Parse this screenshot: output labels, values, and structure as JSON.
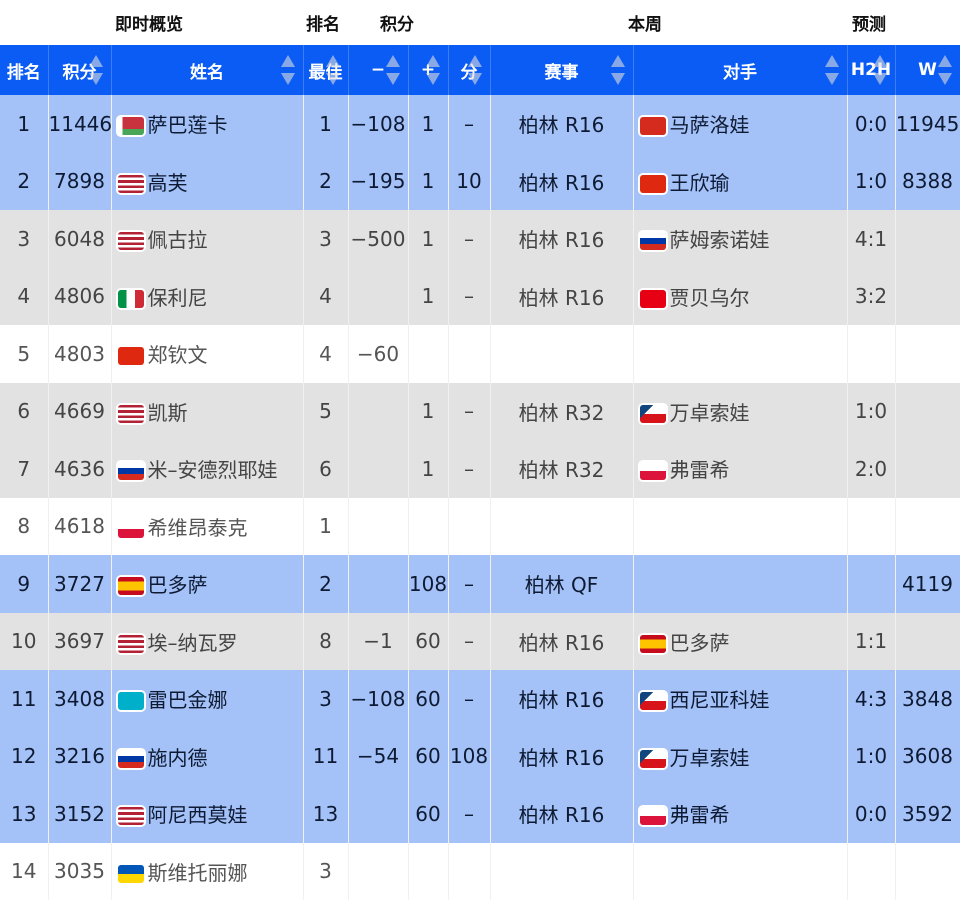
{
  "groups": {
    "live": "即时概览",
    "rank": "排名",
    "points": "积分",
    "week": "本周",
    "forecast": "预测"
  },
  "headers": [
    "排名",
    "积分",
    "姓名",
    "最佳",
    "−",
    "+",
    "分",
    "赛事",
    "对手",
    "H2H",
    "W"
  ],
  "colors": {
    "header": "#0b5cf5",
    "blue_row": "#a4c2f7",
    "gray_row": "#e2e2e2"
  },
  "rows": [
    {
      "rank": "1",
      "pts": "11446",
      "flag": "BLR",
      "name": "萨巴莲卡",
      "best": "1",
      "minus": "−108",
      "plus": "1",
      "fen": "–",
      "event": "柏林 R16",
      "oflag": "SUI",
      "opp": "马萨洛娃",
      "h2h": "0:0",
      "w": "11945",
      "style": "blue"
    },
    {
      "rank": "2",
      "pts": "7898",
      "flag": "USA",
      "name": "高芙",
      "best": "2",
      "minus": "−195",
      "plus": "1",
      "fen": "10",
      "event": "柏林 R16",
      "oflag": "CHN",
      "opp": "王欣瑜",
      "h2h": "1:0",
      "w": "8388",
      "style": "blue"
    },
    {
      "rank": "3",
      "pts": "6048",
      "flag": "USA",
      "name": "佩古拉",
      "best": "3",
      "minus": "−500",
      "plus": "1",
      "fen": "–",
      "event": "柏林 R16",
      "oflag": "RUS",
      "opp": "萨姆索诺娃",
      "h2h": "4:1",
      "w": "",
      "style": "gray"
    },
    {
      "rank": "4",
      "pts": "4806",
      "flag": "ITA",
      "name": "保利尼",
      "best": "4",
      "minus": "",
      "plus": "1",
      "fen": "–",
      "event": "柏林 R16",
      "oflag": "TUN",
      "opp": "贾贝乌尔",
      "h2h": "3:2",
      "w": "",
      "style": "gray"
    },
    {
      "rank": "5",
      "pts": "4803",
      "flag": "CHN",
      "name": "郑钦文",
      "best": "4",
      "minus": "−60",
      "plus": "",
      "fen": "",
      "event": "",
      "oflag": "",
      "opp": "",
      "h2h": "",
      "w": "",
      "style": "white"
    },
    {
      "rank": "6",
      "pts": "4669",
      "flag": "USA",
      "name": "凯斯",
      "best": "5",
      "minus": "",
      "plus": "1",
      "fen": "–",
      "event": "柏林 R32",
      "oflag": "CZE",
      "opp": "万卓索娃",
      "h2h": "1:0",
      "w": "",
      "style": "gray"
    },
    {
      "rank": "7",
      "pts": "4636",
      "flag": "RUS",
      "name": "米–安德烈耶娃",
      "best": "6",
      "minus": "",
      "plus": "1",
      "fen": "–",
      "event": "柏林 R32",
      "oflag": "POL",
      "opp": "弗雷希",
      "h2h": "2:0",
      "w": "",
      "style": "gray"
    },
    {
      "rank": "8",
      "pts": "4618",
      "flag": "POL",
      "name": "希维昂泰克",
      "best": "1",
      "minus": "",
      "plus": "",
      "fen": "",
      "event": "",
      "oflag": "",
      "opp": "",
      "h2h": "",
      "w": "",
      "style": "white"
    },
    {
      "rank": "9",
      "pts": "3727",
      "flag": "ESP",
      "name": "巴多萨",
      "best": "2",
      "minus": "",
      "plus": "108",
      "fen": "–",
      "event": "柏林 QF",
      "oflag": "",
      "opp": "",
      "h2h": "",
      "w": "4119",
      "style": "blue"
    },
    {
      "rank": "10",
      "pts": "3697",
      "flag": "USA",
      "name": "埃–纳瓦罗",
      "best": "8",
      "minus": "−1",
      "plus": "60",
      "fen": "–",
      "event": "柏林 R16",
      "oflag": "ESP",
      "opp": "巴多萨",
      "h2h": "1:1",
      "w": "",
      "style": "gray"
    },
    {
      "rank": "11",
      "pts": "3408",
      "flag": "KAZ",
      "name": "雷巴金娜",
      "best": "3",
      "minus": "−108",
      "plus": "60",
      "fen": "–",
      "event": "柏林 R16",
      "oflag": "CZE",
      "opp": "西尼亚科娃",
      "h2h": "4:3",
      "w": "3848",
      "style": "blue"
    },
    {
      "rank": "12",
      "pts": "3216",
      "flag": "RUS",
      "name": "施内德",
      "best": "11",
      "minus": "−54",
      "plus": "60",
      "fen": "108",
      "event": "柏林 R16",
      "oflag": "CZE",
      "opp": "万卓索娃",
      "h2h": "1:0",
      "w": "3608",
      "style": "blue"
    },
    {
      "rank": "13",
      "pts": "3152",
      "flag": "USA",
      "name": "阿尼西莫娃",
      "best": "13",
      "minus": "",
      "plus": "60",
      "fen": "–",
      "event": "柏林 R16",
      "oflag": "POL",
      "opp": "弗雷希",
      "h2h": "0:0",
      "w": "3592",
      "style": "blue"
    },
    {
      "rank": "14",
      "pts": "3035",
      "flag": "UKR",
      "name": "斯维托丽娜",
      "best": "3",
      "minus": "",
      "plus": "",
      "fen": "",
      "event": "",
      "oflag": "",
      "opp": "",
      "h2h": "",
      "w": "",
      "style": "white"
    }
  ]
}
